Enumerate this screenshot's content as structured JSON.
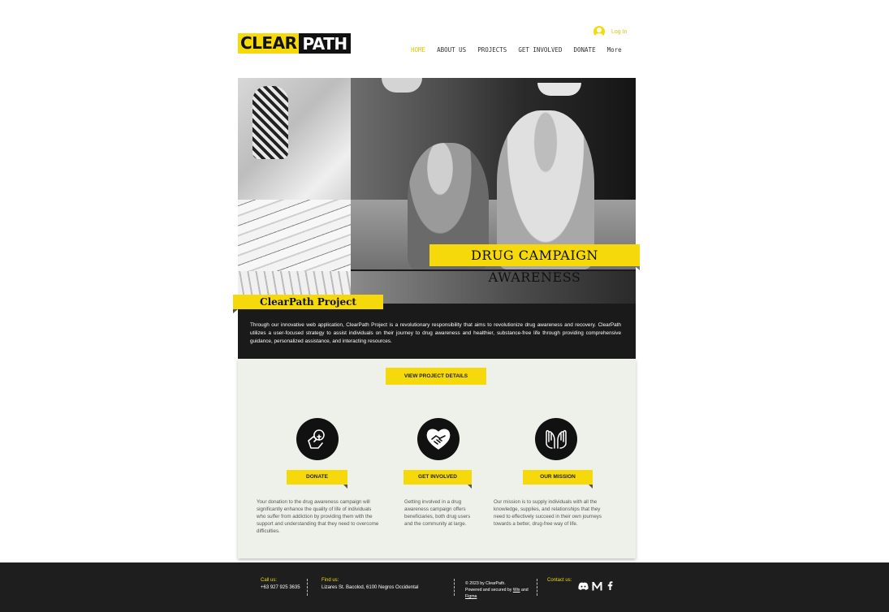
{
  "brand": {
    "logo_left": "CLEAR",
    "logo_right": "PATH"
  },
  "header": {
    "login_label": "Log In",
    "nav": [
      "HOME",
      "ABOUT US",
      "PROJECTS",
      "GET INVOLVED",
      "DONATE",
      "More"
    ]
  },
  "hero": {
    "banner_title": "DRUG CAMPAIGN AWARENESS",
    "project_title": "ClearPath Project",
    "description": "Through our innovative web application, ClearPath Project is a revolutionary responsibility that aims to revolutionize drug awareness and recovery. ClearPath utilizes a user-focused strategy to assist individuals on their journey to drug awareness and healthier, substance-free life through providing comprehensive guidance, personalized assistance, and interacting resources."
  },
  "cta": {
    "view_project_label": "VIEW PROJECT DETAILS"
  },
  "features": [
    {
      "label": "DONATE",
      "icon": "donate-hand-icon",
      "text": "Your donation to the drug awareness campaign will significantly enhance the quality of life of individuals who suffer from addiction by providing them with the support and understanding that they need to overcome difficulties."
    },
    {
      "label": "GET INVOLVED",
      "icon": "heart-handshake-icon",
      "text": "Getting involved in a drug awareness campaign offers beneficiaries, both drug users and the community at large."
    },
    {
      "label": "OUR MISSION",
      "icon": "open-hands-icon",
      "text": "Our mission is to supply individuals with all the knowledge, supplies, and relationships that they need to effectively succeed in their own journeys towards a better, drug-free way of life."
    }
  ],
  "footer": {
    "call_head": "Call us:",
    "call_value": "+63 927 925 3635",
    "find_head": "Find us:",
    "find_value": "Lizares St. Bacolod, 6100 Negros Occidental",
    "copyright_line1": "© 2023 by ClearPath.",
    "copyright_line2_pre": "Powered and secured by",
    "copyright_wix": "Wix",
    "copyright_and": "and",
    "copyright_figma": "Figma",
    "contact_head": "Contact us:"
  },
  "colors": {
    "accent": "#f5d90a",
    "dark": "#1e1e1e",
    "content_bg": "#eef1ea"
  }
}
